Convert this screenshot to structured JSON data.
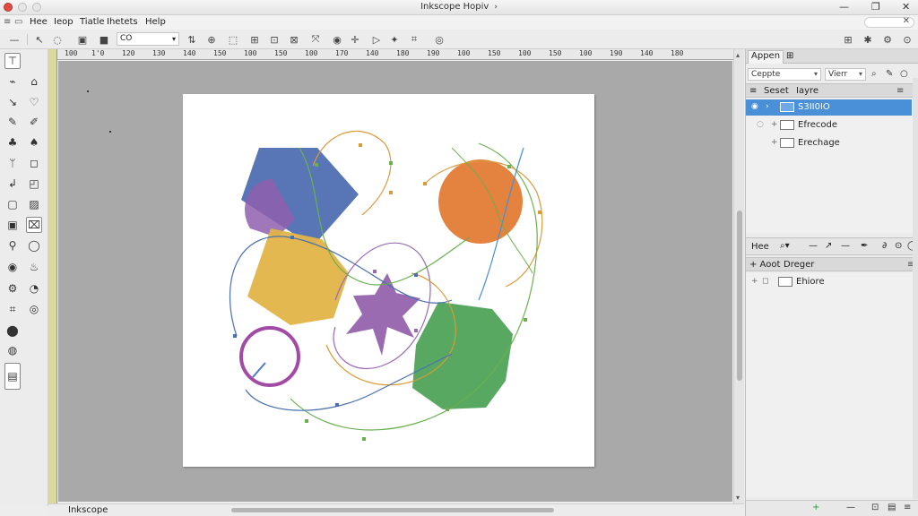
{
  "window": {
    "title": "Inkscope Hopiv",
    "title_arrow": "›",
    "controls": [
      "—",
      "❐",
      "✕"
    ]
  },
  "menubar": {
    "items": [
      "Hee",
      "Ieop",
      "Tiatle",
      "Ihetets",
      "Help"
    ]
  },
  "toolbar": {
    "combo_value": "CO",
    "combo_arrow": "▾"
  },
  "ruler": {
    "ticks": [
      "100",
      "1'0",
      "120",
      "130",
      "140",
      "150",
      "100",
      "150",
      "100",
      "170",
      "140",
      "180",
      "190",
      "100",
      "150",
      "100",
      "150",
      "100",
      "190",
      "140",
      "180"
    ]
  },
  "canvas": {
    "page_color": "#ffffff",
    "colors": {
      "blue": "#4f6fb2",
      "purple": "#8e5fae",
      "yellow": "#e3b448",
      "orange": "#e4823f",
      "green": "#4fa35a",
      "magenta": "#a34aa6",
      "violet": "#9a6bb1"
    }
  },
  "statusbar": {
    "text": "Inkscope"
  },
  "dock": {
    "tabs": [
      "Appen",
      "⊞"
    ],
    "combo1": "Ceppte",
    "combo2": "Vierr",
    "layers_header": {
      "tab1": "Seset",
      "tab2": "Iayre"
    },
    "layers": [
      {
        "name": "S3II0IO",
        "selected": true
      },
      {
        "name": "Efrecode",
        "selected": false
      },
      {
        "name": "Erechage",
        "selected": false
      }
    ],
    "objects_toolbar_label": "Hee",
    "objects_header": {
      "tab1": "+ Aoot",
      "tab2": "Dreger"
    },
    "objects": [
      {
        "name": "Ehiore"
      }
    ]
  }
}
